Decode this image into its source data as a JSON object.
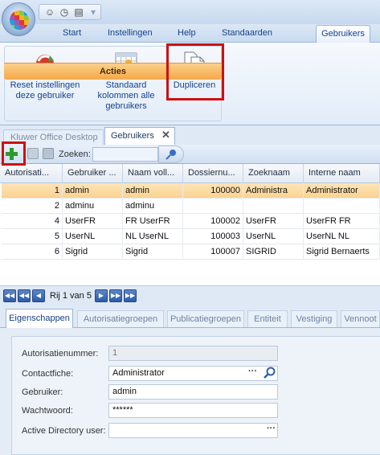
{
  "ribbon": {
    "tabs": [
      "Start",
      "Instellingen",
      "Help",
      "Standaarden"
    ],
    "active_tab": "Gebruikers",
    "buttons": {
      "reset": "Reset instellingen deze gebruiker",
      "standaard": "Standaard kolommen alle gebruikers",
      "dupliceren": "Dupliceren"
    },
    "group_caption": "Acties"
  },
  "doc_tabs": {
    "inactive": "Kluwer Office Desktop",
    "active": "Gebruikers",
    "close_glyph": "✕"
  },
  "toolbar": {
    "search_label": "Zoeken:",
    "search_value": ""
  },
  "grid": {
    "columns": [
      "Autorisati...",
      "Gebruiker ...",
      "Naam voll...",
      "Dossiernu...",
      "Zoeknaam",
      "Interne naam"
    ],
    "rows": [
      {
        "nr": "1",
        "gebruiker": "admin",
        "naam": "admin",
        "dossier": "100000",
        "zoeknaam": "Administra",
        "intern": "Administrator",
        "selected": true
      },
      {
        "nr": "2",
        "gebruiker": "adminu",
        "naam": "adminu",
        "dossier": "",
        "zoeknaam": "",
        "intern": "",
        "selected": false
      },
      {
        "nr": "4",
        "gebruiker": "UserFR",
        "naam": "FR UserFR",
        "dossier": "100002",
        "zoeknaam": "UserFR",
        "intern": "UserFR FR",
        "selected": false
      },
      {
        "nr": "5",
        "gebruiker": "UserNL",
        "naam": "NL UserNL",
        "dossier": "100003",
        "zoeknaam": "UserNL",
        "intern": "UserNL NL",
        "selected": false
      },
      {
        "nr": "6",
        "gebruiker": "Sigrid",
        "naam": "Sigrid",
        "dossier": "100007",
        "zoeknaam": "SIGRID",
        "intern": "Sigrid Bernaerts",
        "selected": false
      }
    ]
  },
  "pager": {
    "text": "Rij 1 van 5"
  },
  "bottom_tabs": [
    "Eigenschappen",
    "Autorisatiegroepen",
    "Publicatiegroepen",
    "Entiteit",
    "Vestiging",
    "Vennoot"
  ],
  "details": {
    "autorisatienummer_label": "Autorisatienummer:",
    "autorisatienummer_value": "1",
    "contactfiche_label": "Contactfiche:",
    "contactfiche_value": "Administrator",
    "gebruiker_label": "Gebruiker:",
    "gebruiker_value": "admin",
    "wachtwoord_label": "Wachtwoord:",
    "wachtwoord_value": "******",
    "ad_label": "Active Directory user:",
    "ad_value": ""
  },
  "colors": {
    "highlight_red": "#cc1111",
    "selected_row": "#fbd291",
    "ribbon_group_caption": "#f6a84a"
  }
}
